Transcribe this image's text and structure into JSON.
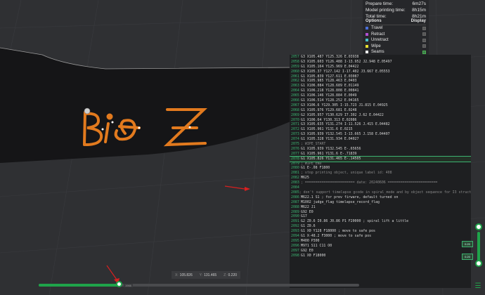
{
  "stats": {
    "prepare_label": "Prepare time:",
    "prepare_value": "6m27s",
    "model_label": "Model printing time:",
    "model_value": "8h15m",
    "total_label": "Total time:",
    "total_value": "8h21m"
  },
  "options": {
    "header_options": "Options",
    "header_display": "Display",
    "items": [
      {
        "label": "Travel",
        "color": "#4a6fd8",
        "checked": false
      },
      {
        "label": "Retract",
        "color": "#b04fd0",
        "checked": false
      },
      {
        "label": "Unretract",
        "color": "#46c0c8",
        "checked": false
      },
      {
        "label": "Wipe",
        "color": "#e8e030",
        "checked": false
      },
      {
        "label": "Seams",
        "color": "#f0f0f0",
        "checked": true
      }
    ]
  },
  "gcode": {
    "active_line": "2078",
    "lines": [
      {
        "n": "2057",
        "t": "G3 X105.487 Y125.326 E.03938"
      },
      {
        "n": "2058",
        "t": "G3 X105.603 Y126.488 I-13.952 J2.948 E.05497"
      },
      {
        "n": "2059",
        "t": "G1 X105.164 Y125.969 E.04422"
      },
      {
        "n": "2060",
        "t": "G3 X105.37 Y127.142 I-17.402 J3.667 E.05553"
      },
      {
        "n": "2061",
        "t": "G1 X105.839 Y127.611 E.03087"
      },
      {
        "n": "2062",
        "t": "G1 X105.985 Y128.463 E.0403"
      },
      {
        "n": "2063",
        "t": "G1 X106.084 Y128.689 E.01149"
      },
      {
        "n": "2064",
        "t": "G1 X106.218 Y128.808 E.00841"
      },
      {
        "n": "2065",
        "t": "G1 X106.146 Y128.884 E.0049"
      },
      {
        "n": "2066",
        "t": "G1 X106.514 Y128.252 E.04165"
      },
      {
        "n": "2067",
        "t": "G3 X106.6 Y129.305 I-15.723 J1.815 E.04925"
      },
      {
        "n": "2068",
        "t": "G1 X105.976 Y129.681 E.0248"
      },
      {
        "n": "2069",
        "t": "G2 X105.957 Y130.629 I7.302 J.62 E.04422"
      },
      {
        "n": "2070",
        "t": "G1 X106.64 Y130.313 E.02086"
      },
      {
        "n": "2071",
        "t": "G3 X105.635 Y131.274 I-11.526 J.415 E.04482"
      },
      {
        "n": "2072",
        "t": "G1 X105.961 Y131.6 E.0215"
      },
      {
        "n": "2073",
        "t": "G3 X105.939 Y132.545 I-13.665 J.158 E.04407"
      },
      {
        "n": "2074",
        "t": "G1 X105.328 Y131.934 E.04027"
      },
      {
        "n": "2075",
        "t": "; WIPE_START",
        "c": true
      },
      {
        "n": "2076",
        "t": "G1 X105.939 Y132.545 E-.65656"
      },
      {
        "n": "2077",
        "t": "G1 X105.961 Y131.6 E-.71839"
      },
      {
        "n": "2078",
        "t": "G1 X105.826 Y131.465 E-.14505"
      },
      {
        "n": "2079",
        "t": "; WIPE_END",
        "c": true
      },
      {
        "n": "2080",
        "t": "G1 E-.08 F1800"
      },
      {
        "n": "2081",
        "t": "; stop printing object, unique label id: 408",
        "c": true
      },
      {
        "n": "2082",
        "t": "M625"
      },
      {
        "n": "2083",
        "t": "; ======================== date: 20240606 ========================",
        "c": true
      },
      {
        "n": "2084",
        "t": ""
      },
      {
        "n": "2085",
        "t": "; don't support timelapse gcode in spiral_mode and by object sequence for I3 structure printer",
        "c": true
      },
      {
        "n": "2086",
        "t": "M622.1 S1 ; for prev firware, default turned on"
      },
      {
        "n": "2087",
        "t": "M1002 judge_flag timelapse_record_flag"
      },
      {
        "n": "2088",
        "t": "M622 J1"
      },
      {
        "n": "2089",
        "t": "G92 E0"
      },
      {
        "n": "2090",
        "t": "G17"
      },
      {
        "n": "2091",
        "t": "G2 Z0.6 I0.86 J0.86 P1 F20000 ; spiral lift a little"
      },
      {
        "n": "2092",
        "t": "G1 Z0.6"
      },
      {
        "n": "2093",
        "t": "G1 X0 Y128 F18000 ; move to safe pos"
      },
      {
        "n": "2094",
        "t": "G1 X-48.2 F3000 ; move to safe pos"
      },
      {
        "n": "2095",
        "t": "M400 P300"
      },
      {
        "n": "2096",
        "t": "M971 S11 C11 O0"
      },
      {
        "n": "2097",
        "t": "G92 E0"
      },
      {
        "n": "2098",
        "t": "G1 X0 F18000"
      }
    ]
  },
  "coords": {
    "x_label": "X:",
    "x": "105.826",
    "y_label": "Y:",
    "y": "131.465",
    "z_label": "Z:",
    "z": "0.220"
  },
  "slider": {
    "progress": 0.25,
    "label": "1966"
  },
  "layer_slider": {
    "top_label": "0.20",
    "bottom_label": "0.20"
  },
  "colors": {
    "accent": "#1fa34a",
    "print_orange": "#e27a1e",
    "panel": "#26272a"
  }
}
